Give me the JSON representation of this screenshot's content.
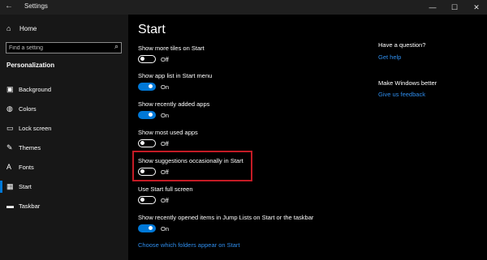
{
  "window": {
    "title": "Settings",
    "back_glyph": "←",
    "minimize_glyph": "—",
    "maximize_glyph": "☐",
    "close_glyph": "✕"
  },
  "sidebar": {
    "home_label": "Home",
    "search_placeholder": "Find a setting",
    "section_label": "Personalization",
    "items": [
      {
        "label": "Background",
        "icon": "image-icon",
        "glyph": "▣"
      },
      {
        "label": "Colors",
        "icon": "palette-icon",
        "glyph": "◍"
      },
      {
        "label": "Lock screen",
        "icon": "lock-screen-icon",
        "glyph": "▭"
      },
      {
        "label": "Themes",
        "icon": "brush-icon",
        "glyph": "✎"
      },
      {
        "label": "Fonts",
        "icon": "font-icon",
        "glyph": "A"
      },
      {
        "label": "Start",
        "icon": "start-icon",
        "glyph": "▦"
      },
      {
        "label": "Taskbar",
        "icon": "taskbar-icon",
        "glyph": "▬"
      }
    ],
    "active_index": 5
  },
  "main": {
    "title": "Start",
    "settings": [
      {
        "label": "Show more tiles on Start",
        "state": "Off",
        "on": false
      },
      {
        "label": "Show app list in Start menu",
        "state": "On",
        "on": true
      },
      {
        "label": "Show recently added apps",
        "state": "On",
        "on": true
      },
      {
        "label": "Show most used apps",
        "state": "Off",
        "on": false
      },
      {
        "label": "Show suggestions occasionally in Start",
        "state": "Off",
        "on": false
      },
      {
        "label": "Use Start full screen",
        "state": "Off",
        "on": false
      },
      {
        "label": "Show recently opened items in Jump Lists on Start or the taskbar",
        "state": "On",
        "on": true
      }
    ],
    "folders_link": "Choose which folders appear on Start"
  },
  "aside": {
    "question_heading": "Have a question?",
    "help_link": "Get help",
    "better_heading": "Make Windows better",
    "feedback_link": "Give us feedback"
  },
  "colors": {
    "accent": "#0078d7",
    "highlight_border": "#c41b25",
    "link": "#2e8ded",
    "sidebar_bg": "#171717",
    "main_bg": "#000000"
  }
}
